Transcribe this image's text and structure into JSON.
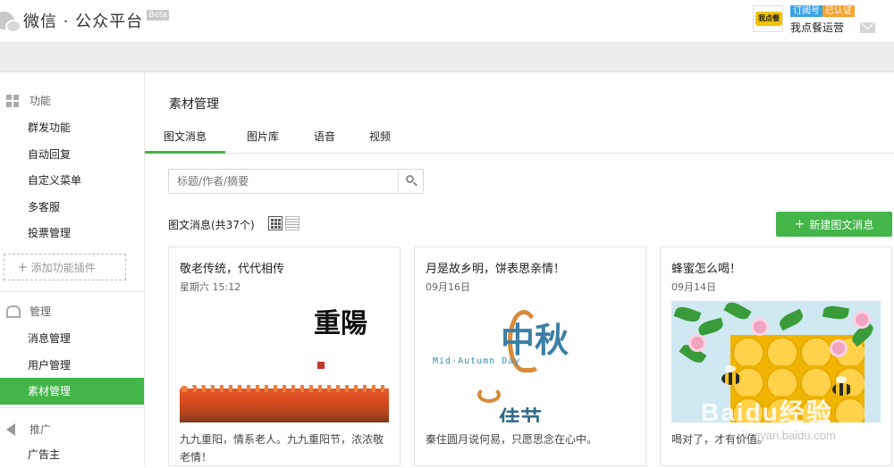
{
  "header": {
    "logo_text": "微信 · 公众平台",
    "beta": "Beta",
    "avatar_text": "我点餐",
    "tag_subscribe": "订阅号",
    "tag_verified": "已认证",
    "account_name": "我点餐运营"
  },
  "sidebar": {
    "sections": [
      {
        "label": "功能",
        "icon": "grid-icon"
      },
      {
        "label": "管理",
        "icon": "tray-icon"
      },
      {
        "label": "推广",
        "icon": "megaphone-icon"
      }
    ],
    "function_items": [
      "群发功能",
      "自动回复",
      "自定义菜单",
      "多客服",
      "投票管理"
    ],
    "add_plugin": "添加功能插件",
    "manage_items": [
      "消息管理",
      "用户管理",
      "素材管理"
    ],
    "promo_items": [
      "广告主"
    ],
    "active_item": "素材管理"
  },
  "main": {
    "title": "素材管理",
    "tabs": [
      "图文消息",
      "图片库",
      "语音",
      "视频"
    ],
    "active_tab": "图文消息",
    "search_placeholder": "标题/作者/摘要",
    "count_label": "图文消息(共37个)",
    "new_button": "新建图文消息"
  },
  "cards": [
    {
      "title": "敬老传统，代代相传",
      "date": "星期六 15:12",
      "desc": "九九重阳，情系老人。九九重阳节，浓浓敬老情！",
      "image_text": "重陽"
    },
    {
      "title": "月是故乡明，饼表思亲情！",
      "date": "09月16日",
      "desc": "秦住圆月说何易，只愿思念在心中。",
      "image_text_en": "Mid-Autumn Day",
      "image_text_cn_big": "中秋",
      "image_text_cn_small": "佳节"
    },
    {
      "title": "蜂蜜怎么喝！",
      "date": "09月14日",
      "desc": "喝对了，才有价值。"
    }
  ],
  "watermark": {
    "text": "Baidu经验",
    "url": "jingyan.baidu.com"
  },
  "colors": {
    "accent": "#44b549",
    "subscribe_tag": "#3fa4e6",
    "verified_tag": "#f4a32f"
  }
}
